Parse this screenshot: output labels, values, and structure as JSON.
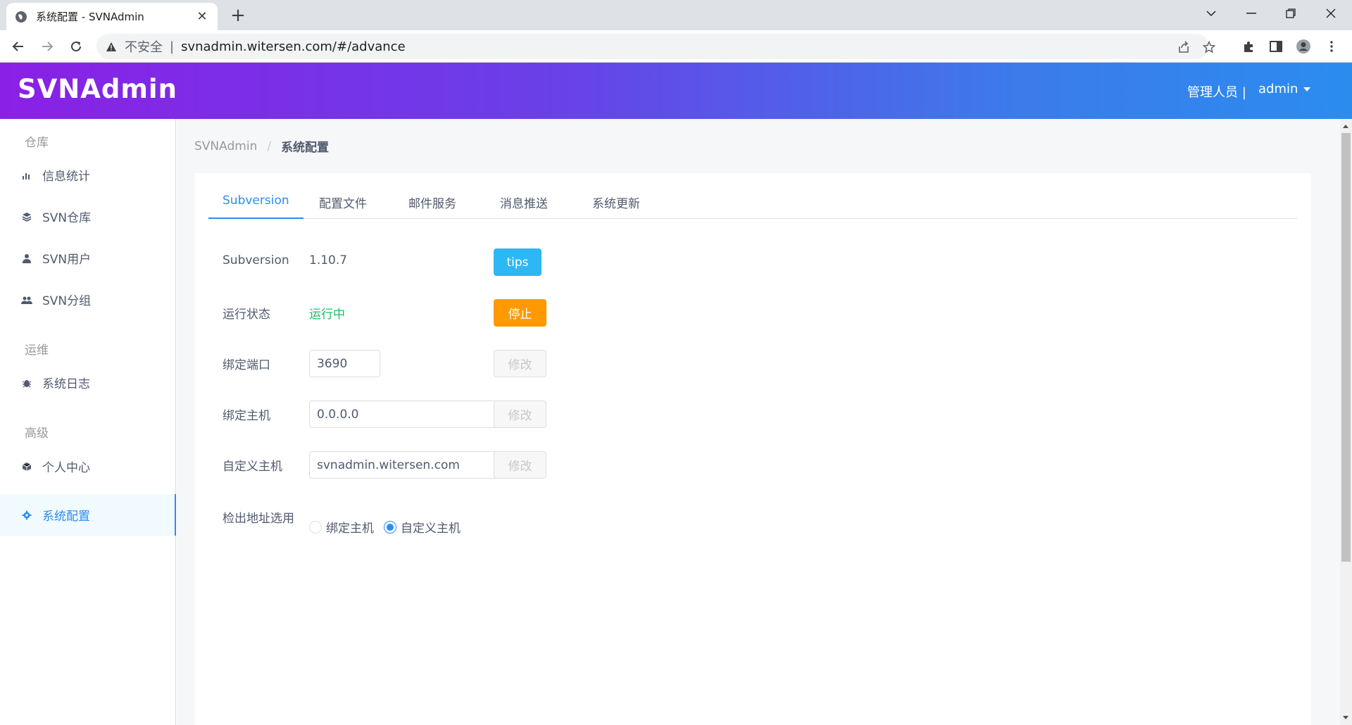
{
  "browser": {
    "tab_title": "系统配置 - SVNAdmin",
    "insecure_label": "不安全",
    "url": "svnadmin.witersen.com/#/advance"
  },
  "header": {
    "logo": "SVNAdmin",
    "role": "管理人员 |",
    "username": "admin"
  },
  "sidebar": {
    "groups": [
      {
        "title": "仓库",
        "items": [
          {
            "label": "信息统计",
            "icon": "bar-chart-icon"
          },
          {
            "label": "SVN仓库",
            "icon": "layers-icon"
          },
          {
            "label": "SVN用户",
            "icon": "user-icon"
          },
          {
            "label": "SVN分组",
            "icon": "group-icon"
          }
        ]
      },
      {
        "title": "运维",
        "items": [
          {
            "label": "系统日志",
            "icon": "bug-icon"
          }
        ]
      },
      {
        "title": "高级",
        "items": [
          {
            "label": "个人中心",
            "icon": "cube-icon"
          },
          {
            "label": "系统配置",
            "icon": "gear-icon",
            "active": true
          }
        ]
      }
    ]
  },
  "breadcrumb": [
    "SVNAdmin",
    "系统配置"
  ],
  "tabs": [
    "Subversion",
    "配置文件",
    "邮件服务",
    "消息推送",
    "系统更新"
  ],
  "form": {
    "subversion_label": "Subversion",
    "subversion_version": "1.10.7",
    "tips_button": "tips",
    "status_label": "运行状态",
    "status_value": "运行中",
    "stop_button": "停止",
    "port_label": "绑定端口",
    "port_value": "3690",
    "host_label": "绑定主机",
    "host_value": "0.0.0.0",
    "custom_host_label": "自定义主机",
    "custom_host_value": "svnadmin.witersen.com",
    "modify_button": "修改",
    "checkout_label": "检出地址选用",
    "checkout_options": [
      "绑定主机",
      "自定义主机"
    ],
    "checkout_selected": "自定义主机"
  },
  "colors": {
    "primary": "#2d8cf0",
    "success": "#19be6b",
    "warning": "#ff9900",
    "info": "#2db7f5"
  }
}
